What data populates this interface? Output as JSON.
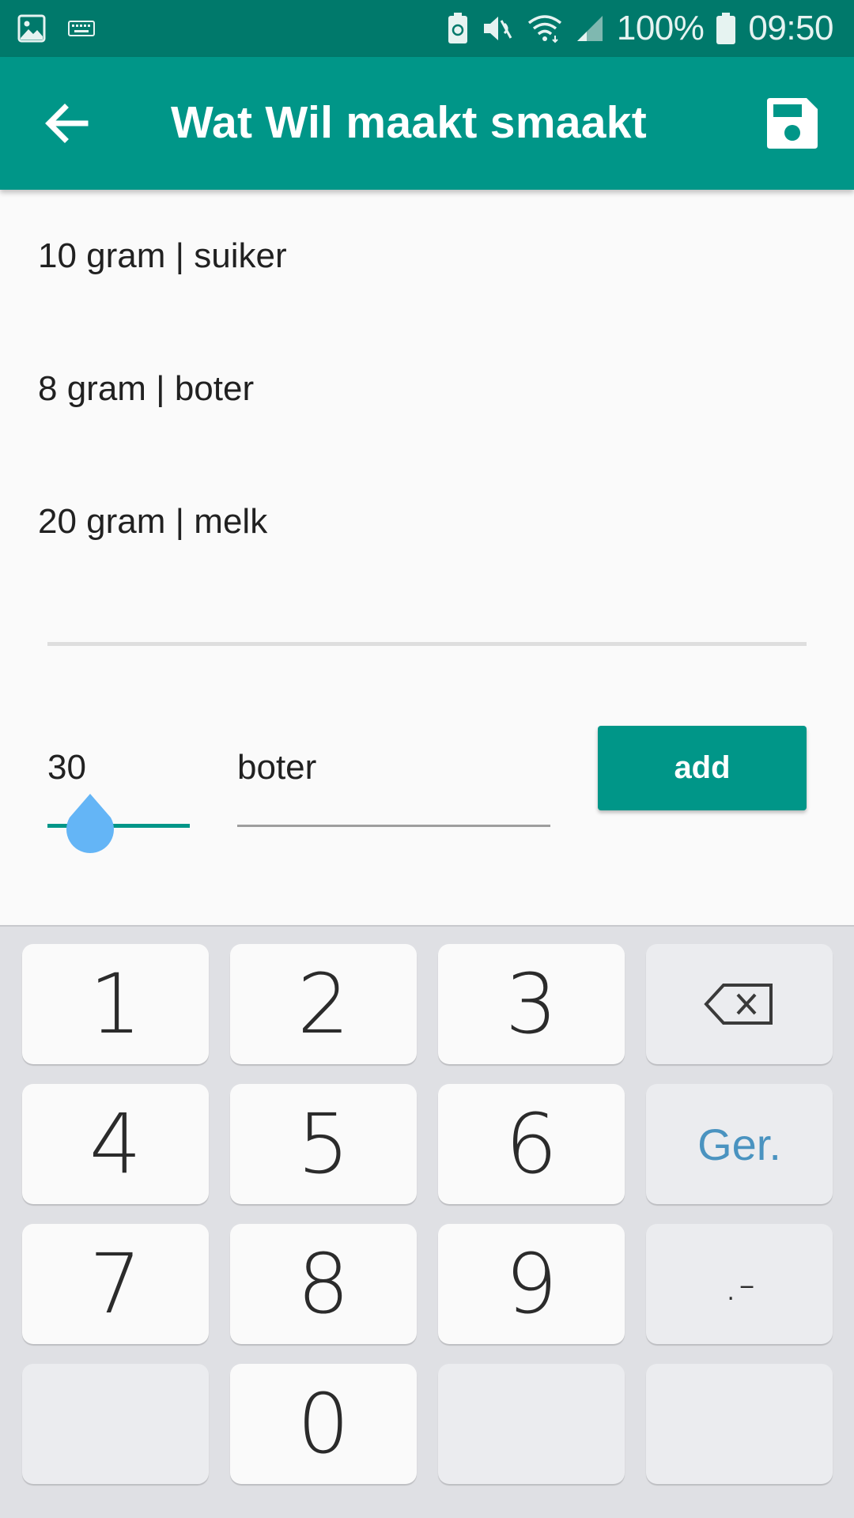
{
  "status_bar": {
    "battery_percent": "100%",
    "time": "09:50",
    "icons": [
      "image-icon",
      "keyboard-icon",
      "battery-saver-icon",
      "mute-icon",
      "wifi-icon",
      "signal-icon",
      "battery-icon"
    ]
  },
  "app_bar": {
    "title": "Wat Wil maakt smaakt",
    "back_icon": "arrow-back-icon",
    "save_icon": "save-icon"
  },
  "ingredients": [
    {
      "label": "10 gram | suiker"
    },
    {
      "label": "8 gram | boter"
    },
    {
      "label": "20 gram | melk"
    }
  ],
  "input_row": {
    "quantity": "30",
    "ingredient_name": "boter",
    "add_label": "add"
  },
  "keyboard": {
    "keys": {
      "k1": "1",
      "k2": "2",
      "k3": "3",
      "k4": "4",
      "k5": "5",
      "k6": "6",
      "k7": "7",
      "k8": "8",
      "k9": "9",
      "k0": "0",
      "done": "Ger.",
      "symbols": ".-"
    },
    "backspace_icon": "backspace-icon"
  },
  "colors": {
    "status_bar": "#00796b",
    "primary": "#009688",
    "slider_thumb": "#64b5f6",
    "keyboard_bg": "#dfe0e4"
  }
}
